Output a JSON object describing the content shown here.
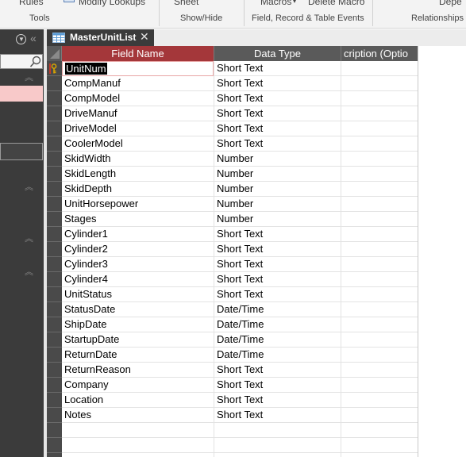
{
  "ribbon": {
    "rules_text": "Rules",
    "modify_lookups_text": "Modify Lookups",
    "sheet_text": "Sheet",
    "macros_text": "Macros",
    "delete_macro_text": "Delete Macro",
    "depe_text": "Depe",
    "groups": [
      "Tools",
      "Show/Hide",
      "Field, Record & Table Events",
      "Relationships"
    ]
  },
  "nav": {
    "header_chevron": "⦿",
    "collapse": "«"
  },
  "tab": {
    "label": "MasterUnitList",
    "close": "✕"
  },
  "grid": {
    "headers": {
      "field_name": "Field Name",
      "data_type": "Data Type",
      "description": "cription (Optio"
    },
    "rows": [
      {
        "field": "UnitNum",
        "type": "Short Text",
        "key": true
      },
      {
        "field": "CompManuf",
        "type": "Short Text"
      },
      {
        "field": "CompModel",
        "type": "Short Text"
      },
      {
        "field": "DriveManuf",
        "type": "Short Text"
      },
      {
        "field": "DriveModel",
        "type": "Short Text"
      },
      {
        "field": "CoolerModel",
        "type": "Short Text"
      },
      {
        "field": "SkidWidth",
        "type": "Number"
      },
      {
        "field": "SkidLength",
        "type": "Number"
      },
      {
        "field": "SkidDepth",
        "type": "Number"
      },
      {
        "field": "UnitHorsepower",
        "type": "Number"
      },
      {
        "field": "Stages",
        "type": "Number"
      },
      {
        "field": "Cylinder1",
        "type": "Short Text"
      },
      {
        "field": "Cylinder2",
        "type": "Short Text"
      },
      {
        "field": "Cylinder3",
        "type": "Short Text"
      },
      {
        "field": "Cylinder4",
        "type": "Short Text"
      },
      {
        "field": "UnitStatus",
        "type": "Short Text"
      },
      {
        "field": "StatusDate",
        "type": "Date/Time"
      },
      {
        "field": "ShipDate",
        "type": "Date/Time"
      },
      {
        "field": "StartupDate",
        "type": "Date/Time"
      },
      {
        "field": "ReturnDate",
        "type": "Date/Time"
      },
      {
        "field": "ReturnReason",
        "type": "Short Text"
      },
      {
        "field": "Company",
        "type": "Short Text"
      },
      {
        "field": "Location",
        "type": "Short Text"
      },
      {
        "field": "Notes",
        "type": "Short Text"
      },
      {
        "field": "",
        "type": ""
      },
      {
        "field": "",
        "type": ""
      },
      {
        "field": "",
        "type": ""
      }
    ]
  },
  "colors": {
    "accent": "#a4373a",
    "header_bg": "#5a5a5a",
    "nav_bg": "#3b3b3b",
    "selected_nav_item": "#f8c9c9"
  }
}
